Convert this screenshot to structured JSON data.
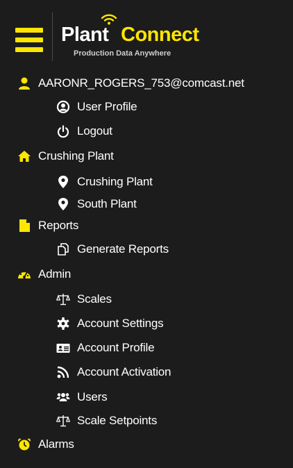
{
  "app": {
    "logo_word1": "Plant",
    "logo_word2": "Connect",
    "logo_tagline": "Production Data Anywhere"
  },
  "menu": {
    "user": {
      "label": "AARONR_ROGERS_753@comcast.net",
      "icon": "user-icon",
      "children": [
        {
          "label": "User Profile",
          "icon": "user-circle-icon"
        },
        {
          "label": "Logout",
          "icon": "power-icon"
        }
      ]
    },
    "plants": {
      "label": "Crushing Plant",
      "icon": "home-icon",
      "children": [
        {
          "label": "Crushing Plant",
          "icon": "map-marker-icon"
        },
        {
          "label": "South Plant",
          "icon": "map-marker-icon"
        }
      ]
    },
    "reports": {
      "label": "Reports",
      "icon": "file-icon",
      "children": [
        {
          "label": "Generate Reports",
          "icon": "copy-files-icon"
        }
      ]
    },
    "admin": {
      "label": "Admin",
      "icon": "dashboard-gauge-icon",
      "children": [
        {
          "label": "Scales",
          "icon": "balance-scale-icon"
        },
        {
          "label": "Account Settings",
          "icon": "gear-icon"
        },
        {
          "label": "Account Profile",
          "icon": "id-card-icon"
        },
        {
          "label": "Account Activation",
          "icon": "rss-feed-icon"
        },
        {
          "label": "Users",
          "icon": "users-icon"
        },
        {
          "label": "Scale Setpoints",
          "icon": "balance-scale-icon"
        }
      ]
    },
    "alarms": {
      "label": "Alarms",
      "icon": "alarm-clock-icon"
    }
  },
  "colors": {
    "background": "#1c1c1c",
    "accent": "#ffe600",
    "text": "#ffffff",
    "muted_text": "#cfcfcf",
    "divider": "#4a4a4a"
  }
}
